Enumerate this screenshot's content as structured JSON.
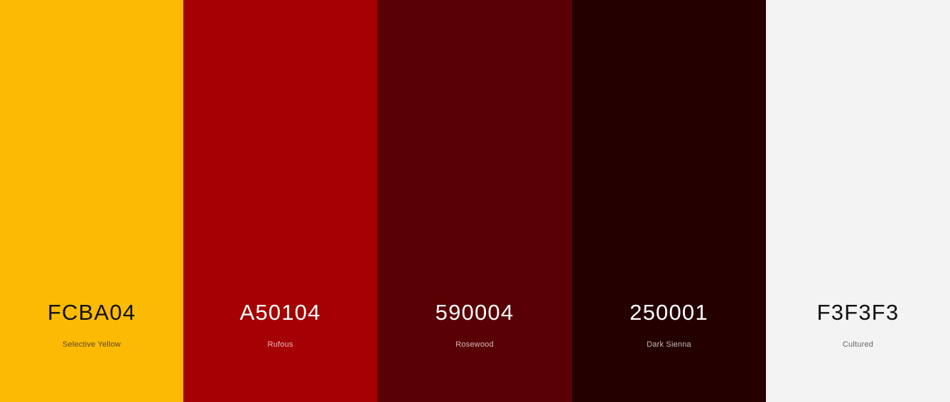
{
  "palette": {
    "swatches": [
      {
        "hex": "FCBA04",
        "name": "Selective Yellow",
        "color": "#FCBA04"
      },
      {
        "hex": "A50104",
        "name": "Rufous",
        "color": "#A50104"
      },
      {
        "hex": "590004",
        "name": "Rosewood",
        "color": "#590004"
      },
      {
        "hex": "250001",
        "name": "Dark Sienna",
        "color": "#250001"
      },
      {
        "hex": "F3F3F3",
        "name": "Cultured",
        "color": "#F3F3F3"
      }
    ]
  }
}
